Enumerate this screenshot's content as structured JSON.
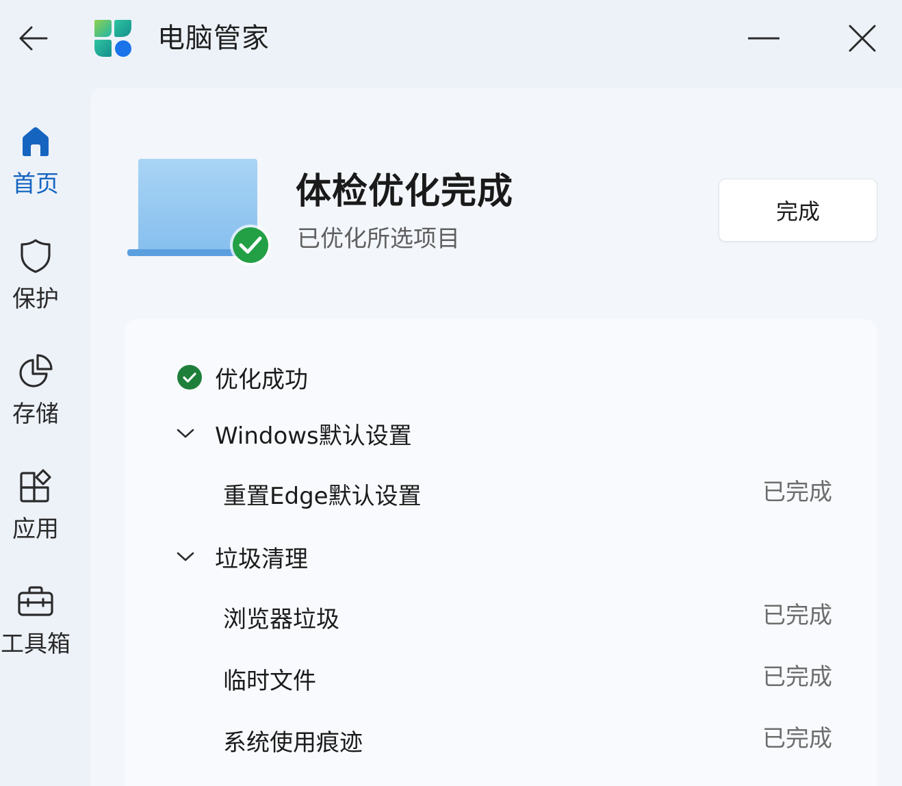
{
  "app": {
    "title": "电脑管家",
    "logo_icon": "pc-manager-logo",
    "back_icon": "back-arrow-icon",
    "minimize_icon": "minimize-icon",
    "close_icon": "close-icon"
  },
  "sidebar": {
    "items": [
      {
        "label": "首页",
        "icon": "home-icon",
        "active": true
      },
      {
        "label": "保护",
        "icon": "shield-icon",
        "active": false
      },
      {
        "label": "存储",
        "icon": "pie-chart-icon",
        "active": false
      },
      {
        "label": "应用",
        "icon": "apps-icon",
        "active": false
      },
      {
        "label": "工具箱",
        "icon": "toolbox-icon",
        "active": false
      }
    ]
  },
  "hero": {
    "title": "体检优化完成",
    "subtitle": "已优化所选项目",
    "done_button": "完成"
  },
  "result": {
    "status": "优化成功",
    "groups": [
      {
        "name": "Windows默认设置",
        "items": [
          {
            "name": "重置Edge默认设置",
            "status": "已完成"
          }
        ]
      },
      {
        "name": "垃圾清理",
        "items": [
          {
            "name": "浏览器垃圾",
            "status": "已完成"
          },
          {
            "name": "临时文件",
            "status": "已完成"
          },
          {
            "name": "系统使用痕迹",
            "status": "已完成"
          }
        ]
      }
    ]
  },
  "colors": {
    "accent": "#1565c0",
    "success": "#1e8e3e",
    "background": "#edf2f9"
  }
}
